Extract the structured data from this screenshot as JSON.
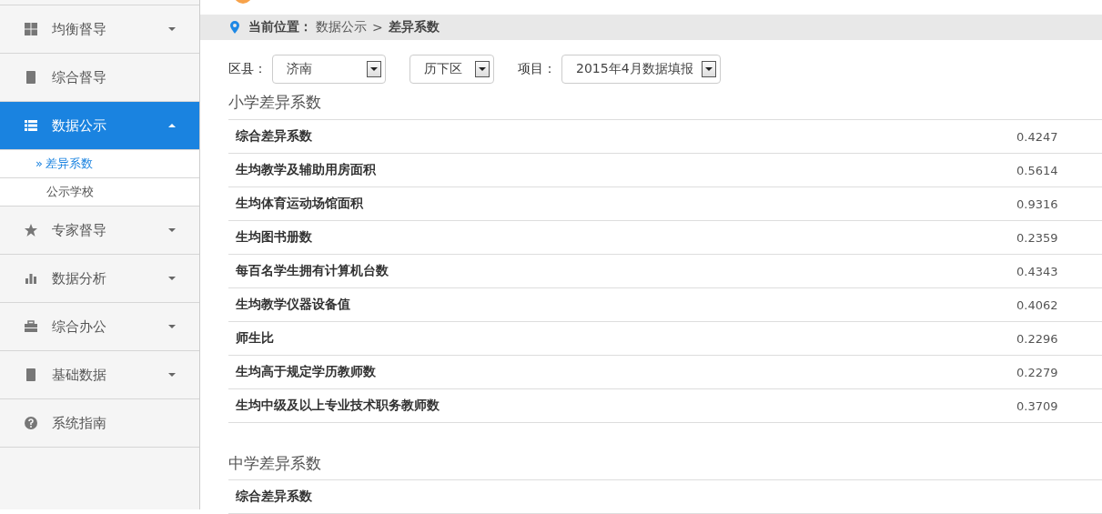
{
  "sidebar": {
    "items": [
      {
        "label": "均衡督导",
        "selected": false,
        "expanded": false
      },
      {
        "label": "综合督导",
        "selected": false
      },
      {
        "label": "数据公示",
        "selected": true,
        "expanded": true,
        "children": [
          {
            "label": "差异系数",
            "selected": true,
            "marker": "»"
          },
          {
            "label": "公示学校",
            "selected": false
          }
        ]
      },
      {
        "label": "专家督导",
        "selected": false,
        "expanded": false
      },
      {
        "label": "数据分析",
        "selected": false,
        "expanded": false
      },
      {
        "label": "综合办公",
        "selected": false,
        "expanded": false
      },
      {
        "label": "基础数据",
        "selected": false,
        "expanded": false
      },
      {
        "label": "系统指南",
        "selected": false
      }
    ]
  },
  "breadcrumb": {
    "label": "当前位置：",
    "path": "数据公示",
    "separator": ">",
    "current": "差异系数"
  },
  "filters": {
    "county_label": "区县：",
    "city": "济南",
    "district": "历下区",
    "project_label": "项目：",
    "project": "2015年4月数据填报"
  },
  "sections": [
    {
      "title": "小学差异系数",
      "rows": [
        {
          "name": "综合差异系数",
          "value": "0.4247"
        },
        {
          "name": "生均教学及辅助用房面积",
          "value": "0.5614"
        },
        {
          "name": "生均体育运动场馆面积",
          "value": "0.9316"
        },
        {
          "name": "生均图书册数",
          "value": "0.2359"
        },
        {
          "name": "每百名学生拥有计算机台数",
          "value": "0.4343"
        },
        {
          "name": "生均教学仪器设备值",
          "value": "0.4062"
        },
        {
          "name": "师生比",
          "value": "0.2296"
        },
        {
          "name": "生均高于规定学历教师数",
          "value": "0.2279"
        },
        {
          "name": "生均中级及以上专业技术职务教师数",
          "value": "0.3709"
        }
      ]
    },
    {
      "title": "中学差异系数",
      "rows": [
        {
          "name": "综合差异系数"
        }
      ]
    }
  ]
}
